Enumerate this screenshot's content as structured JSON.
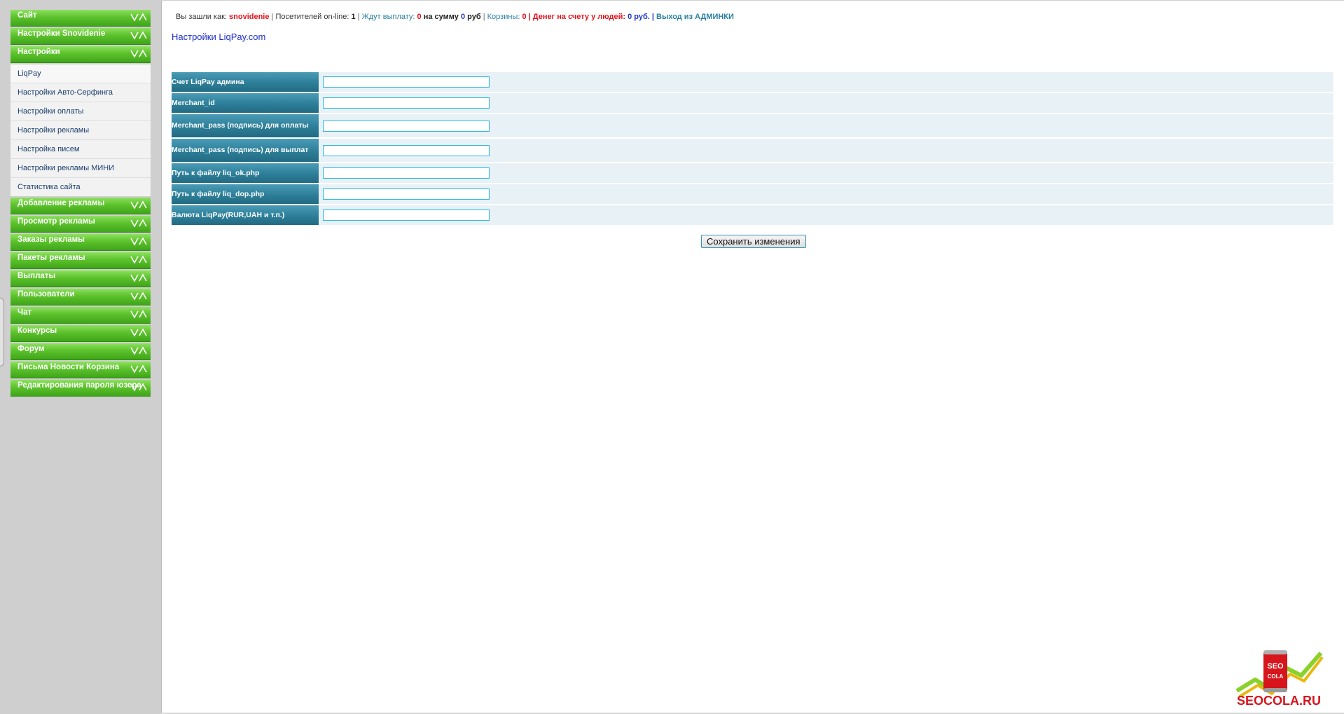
{
  "sidebar": {
    "top_groups": [
      {
        "label": "Сайт"
      },
      {
        "label": "Настройки Snovidenie"
      },
      {
        "label": "Настройки"
      }
    ],
    "settings_items": [
      {
        "label": "LiqPay"
      },
      {
        "label": "Настройки Авто-Серфинга"
      },
      {
        "label": "Настройки оплаты"
      },
      {
        "label": "Настройки рекламы"
      },
      {
        "label": "Настройка писем"
      },
      {
        "label": "Настройки рекламы МИНИ"
      },
      {
        "label": "Статистика сайта"
      }
    ],
    "bottom_groups": [
      {
        "label": "Добавление рекламы"
      },
      {
        "label": "Просмотр рекламы"
      },
      {
        "label": "Заказы рекламы"
      },
      {
        "label": "Пакеты рекламы"
      },
      {
        "label": "Выплаты"
      },
      {
        "label": "Пользователи"
      },
      {
        "label": "Чат"
      },
      {
        "label": "Конкурсы"
      },
      {
        "label": "Форум"
      },
      {
        "label": "Письма Новости Корзина"
      },
      {
        "label": "Редактирования пароля юзера"
      }
    ]
  },
  "infobar": {
    "logged_in_label": "Вы зашли как:",
    "username": "snovidenie",
    "sep1": "|",
    "online_label": "Посетителей on-line:",
    "online_count": "1",
    "sep2": "|",
    "waiting_label": "Ждут выплату:",
    "waiting_count": "0",
    "sum_label": "на сумму",
    "sum_value": "0",
    "currency": "руб",
    "sep3": "|",
    "carts_label": "Корзины:",
    "carts_count": "0",
    "money_label": "| Денег на счету у людей:",
    "money_value": "0 руб.",
    "sep4": "|",
    "exit_label": "Выход из АДМИНКИ"
  },
  "page_title": "Настройки LiqPay.com",
  "form": {
    "rows": [
      {
        "label": "Счет LiqPay админа",
        "value": ""
      },
      {
        "label": "Merchant_id",
        "value": ""
      },
      {
        "label": "Merchant_pass (подпись) для оплаты",
        "value": ""
      },
      {
        "label": "Merchant_pass (подпись) для выплат",
        "value": ""
      },
      {
        "label": "Путь к файлу liq_ok.php",
        "value": ""
      },
      {
        "label": "Путь к файлу liq_dop.php",
        "value": ""
      },
      {
        "label": "Валюта LiqPay(RUR,UAH и т.п.)",
        "value": ""
      }
    ],
    "save_label": "Сохранить изменения"
  },
  "logo": {
    "text": "SEOCOLA.RU",
    "can_text_top": "SEO",
    "can_text_bottom": "COLA"
  }
}
